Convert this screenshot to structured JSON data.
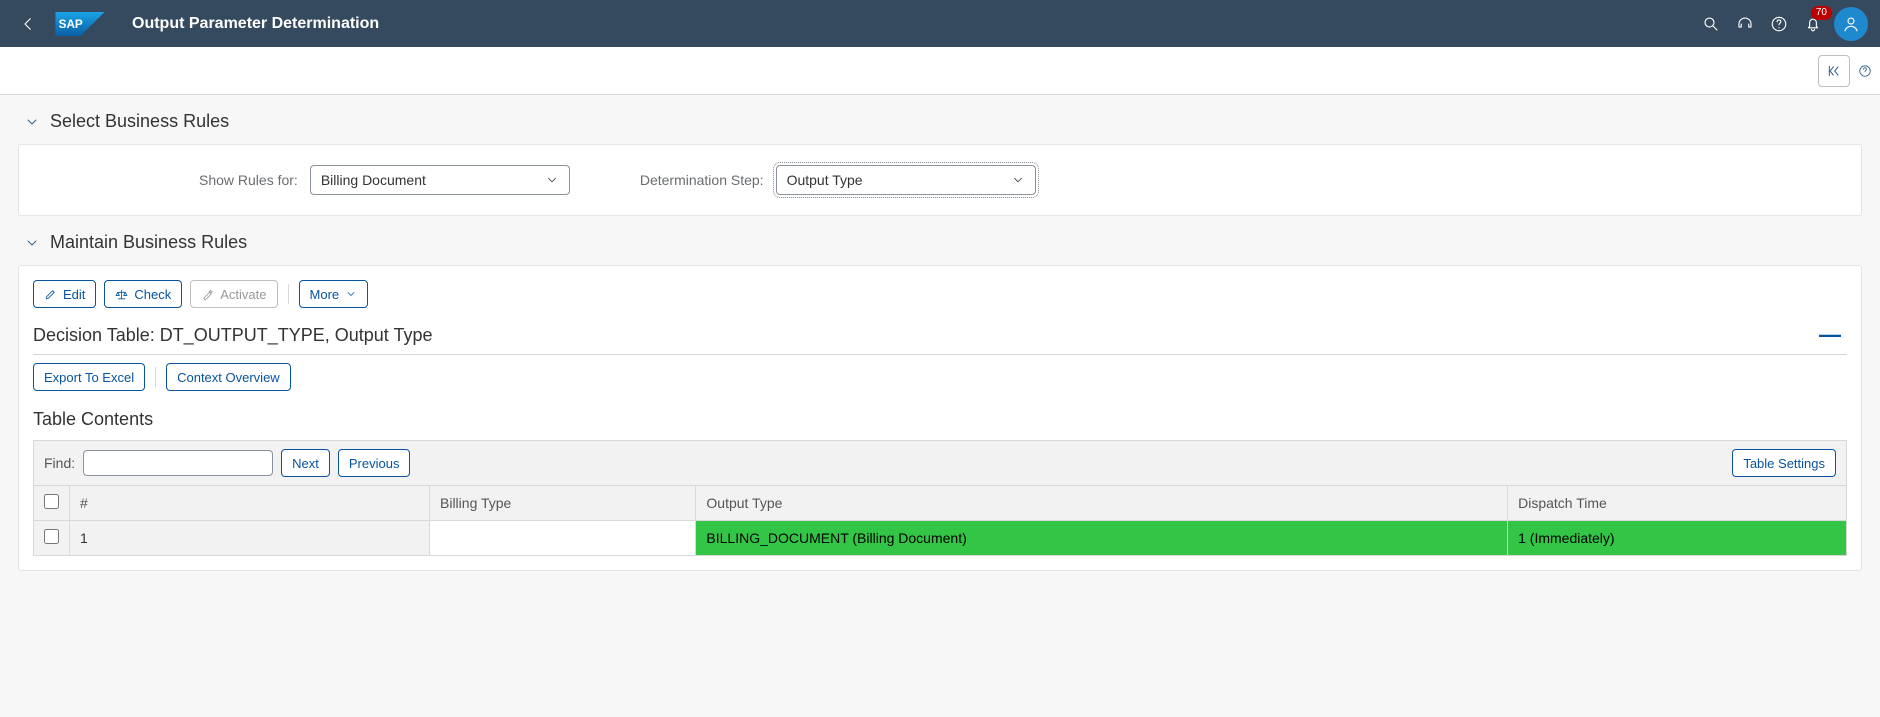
{
  "header": {
    "title": "Output Parameter Determination",
    "notif_count": "70"
  },
  "sections": {
    "select_rules": "Select Business Rules",
    "maintain_rules": "Maintain Business Rules"
  },
  "form": {
    "show_rules_label": "Show Rules for:",
    "show_rules_value": "Billing Document",
    "determination_label": "Determination Step:",
    "determination_value": "Output Type"
  },
  "toolbar": {
    "edit": "Edit",
    "check": "Check",
    "activate": "Activate",
    "more": "More"
  },
  "decision_table": {
    "title": "Decision Table: DT_OUTPUT_TYPE, Output Type",
    "export": "Export To Excel",
    "context": "Context Overview"
  },
  "table_contents": {
    "title": "Table Contents",
    "find_label": "Find:",
    "next": "Next",
    "previous": "Previous",
    "table_settings": "Table Settings",
    "columns": {
      "index": "#",
      "billing_type": "Billing Type",
      "output_type": "Output Type",
      "dispatch_time": "Dispatch Time"
    },
    "rows": [
      {
        "index": "1",
        "billing_type": "",
        "output_type": "BILLING_DOCUMENT (Billing Document)",
        "dispatch_time": "1 (Immediately)"
      }
    ]
  }
}
